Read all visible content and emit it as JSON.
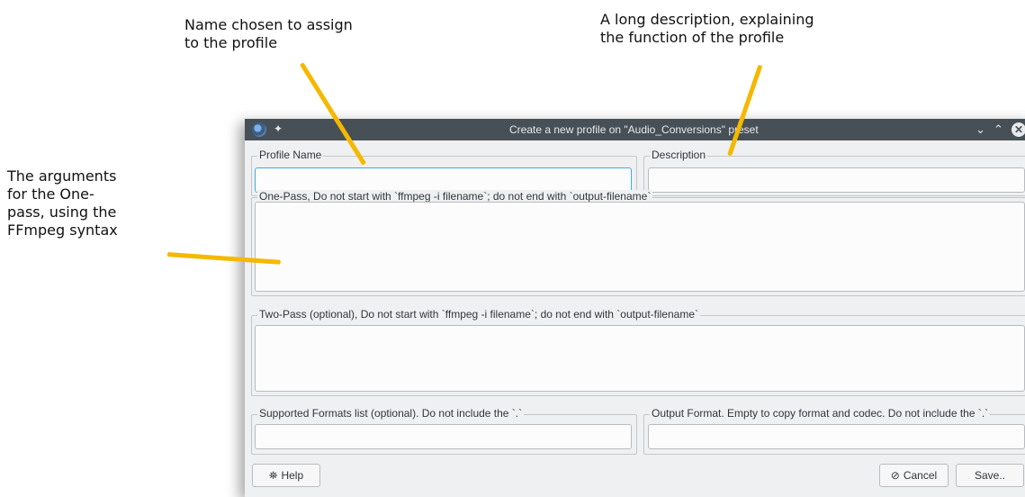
{
  "annotations": {
    "name_note": "Name chosen to assign\nto the profile",
    "description_note": "A long description, explaining\nthe function of the profile",
    "arguments_note": "The arguments\nfor the One-\npass, using the\nFFmpeg syntax"
  },
  "dialog": {
    "title": "Create a new profile on \"Audio_Conversions\" preset",
    "profile_name_label": "Profile Name",
    "profile_name_value": "",
    "description_label": "Description",
    "description_value": "",
    "one_pass_label": "One-Pass, Do not start with `ffmpeg -i filename`; do not end with `output-filename`",
    "two_pass_label": "Two-Pass (optional), Do not start with `ffmpeg -i filename`; do not end with `output-filename`",
    "supported_formats_label": "Supported Formats list (optional). Do not include the `.`",
    "output_format_label": "Output Format. Empty to copy format and codec. Do not include the `.`",
    "help_label": "Help",
    "cancel_label": "Cancel",
    "save_label": "Save.."
  },
  "colors": {
    "titlebar": "#475057",
    "window_bg": "#eff0f1",
    "focus": "#3daee9",
    "callout": "#f5b800"
  },
  "icons": [
    "app-icon",
    "pin-icon",
    "minimize-icon",
    "maximize-icon",
    "close-icon",
    "help-icon",
    "cancel-icon"
  ]
}
